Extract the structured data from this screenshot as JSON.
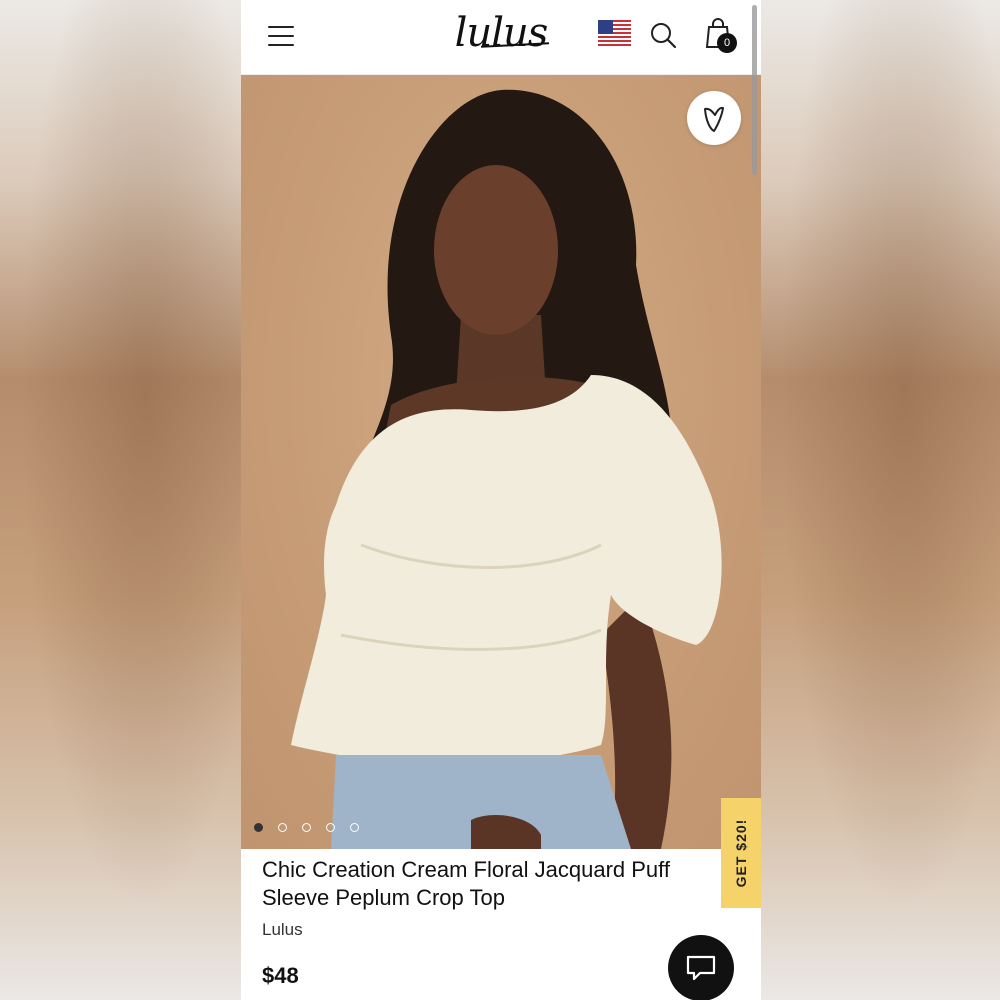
{
  "header": {
    "logo_text": "lulus",
    "menu_icon": "hamburger-menu-icon",
    "flag_icon": "us-flag-icon",
    "search_icon": "search-icon",
    "bag_icon": "shopping-bag-icon",
    "bag_count": "0"
  },
  "gallery": {
    "wishlist_icon": "heart-icon",
    "dot_count": 5,
    "active_dot": 0,
    "background_color": "#c89e78"
  },
  "promo": {
    "label": "GET $20!",
    "color": "#f5d36a"
  },
  "product": {
    "title": "Chic Creation Cream Floral Jacquard Puff Sleeve Peplum Crop Top",
    "brand": "Lulus",
    "price": "$48"
  },
  "chat": {
    "icon": "chat-bubble-icon"
  }
}
